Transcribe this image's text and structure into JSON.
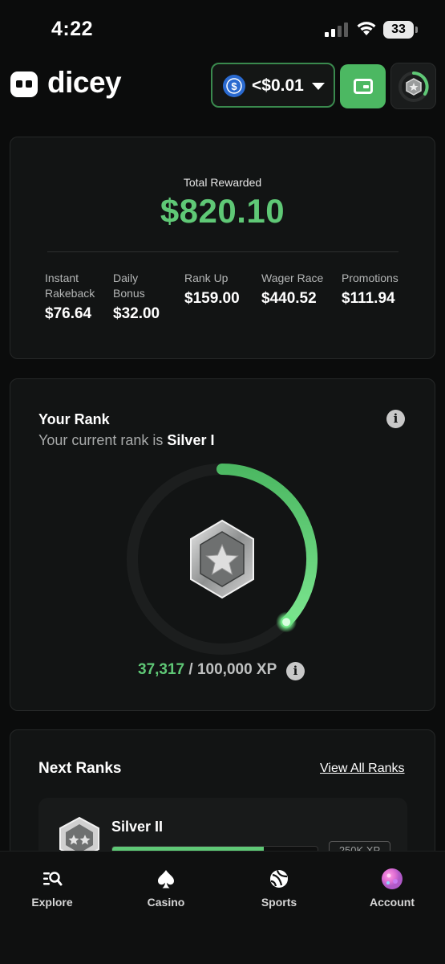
{
  "status_bar": {
    "time": "4:22",
    "battery": "33"
  },
  "header": {
    "logo_text": "dicey",
    "balance": "<$0.01",
    "currency_icon": "usdc-icon",
    "wallet_icon": "wallet-icon",
    "accent_color": "#4cb862"
  },
  "rewards": {
    "total_label": "Total Rewarded",
    "total_value": "$820.10",
    "items": [
      {
        "label_line1": "Instant",
        "label_line2": "Rakeback",
        "value": "$76.64"
      },
      {
        "label_line1": "Daily",
        "label_line2": "Bonus",
        "value": "$32.00"
      },
      {
        "label_line1": "Rank Up",
        "label_line2": "",
        "value": "$159.00"
      },
      {
        "label_line1": "Wager Race",
        "label_line2": "",
        "value": "$440.52"
      },
      {
        "label_line1": "Promotions",
        "label_line2": "",
        "value": "$111.94"
      }
    ]
  },
  "rank": {
    "title": "Your Rank",
    "subtitle_prefix": "Your current rank is ",
    "current_rank": "Silver I",
    "xp_current": "37,317",
    "xp_rest": " / 100,000 XP",
    "progress": 0.37317,
    "ring_color": "#5fc876"
  },
  "next_ranks": {
    "title": "Next Ranks",
    "view_all": "View All Ranks",
    "items": [
      {
        "name": "Silver II",
        "xp_badge": "250K XP",
        "progress": 0.74
      }
    ]
  },
  "nav": {
    "items": [
      {
        "label": "Explore",
        "icon": "explore-icon"
      },
      {
        "label": "Casino",
        "icon": "spade-icon"
      },
      {
        "label": "Sports",
        "icon": "sports-icon"
      },
      {
        "label": "Account",
        "icon": "avatar-icon"
      }
    ]
  }
}
